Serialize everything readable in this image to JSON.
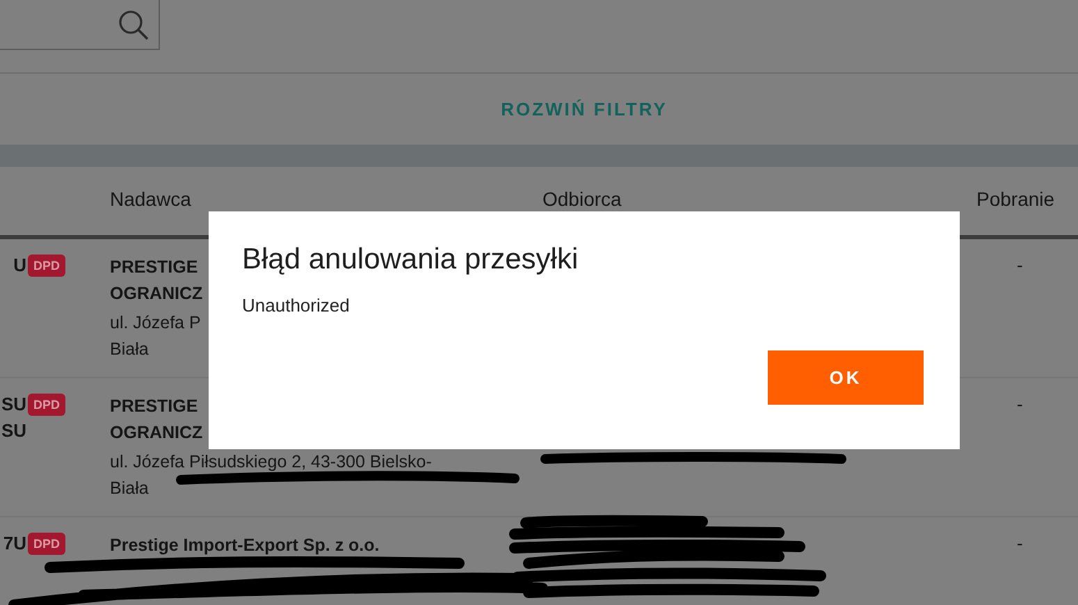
{
  "filters": {
    "toggle": "ROZWIŃ FILTRY"
  },
  "table": {
    "columns": [
      "Nadawca",
      "Odbiorca",
      "Pobranie"
    ],
    "rows": [
      {
        "number": [
          "U"
        ],
        "carrier": "DPD",
        "sender": [
          "PRESTIGE",
          "OGRANICZ"
        ],
        "sender_address": [
          "ul. Józefa P",
          "Biała"
        ],
        "recipient": [],
        "cod": "-"
      },
      {
        "number": [
          "SU",
          "SU"
        ],
        "carrier": "DPD",
        "sender": [
          "PRESTIGE",
          "OGRANICZ"
        ],
        "sender_address": [
          "ul. Józefa Piłsudskiego 2, 43-300 Bielsko-",
          "Biała"
        ],
        "recipient": [],
        "cod": "-"
      },
      {
        "number": [
          "7U"
        ],
        "carrier": "DPD",
        "sender": [
          "Prestige Import-Export Sp. z o.o."
        ],
        "sender_address": [],
        "recipient": [],
        "cod": "-"
      }
    ]
  },
  "dialog": {
    "title": "Błąd anulowania przesyłki",
    "message": "Unauthorized",
    "buttons": [
      "OK"
    ]
  }
}
